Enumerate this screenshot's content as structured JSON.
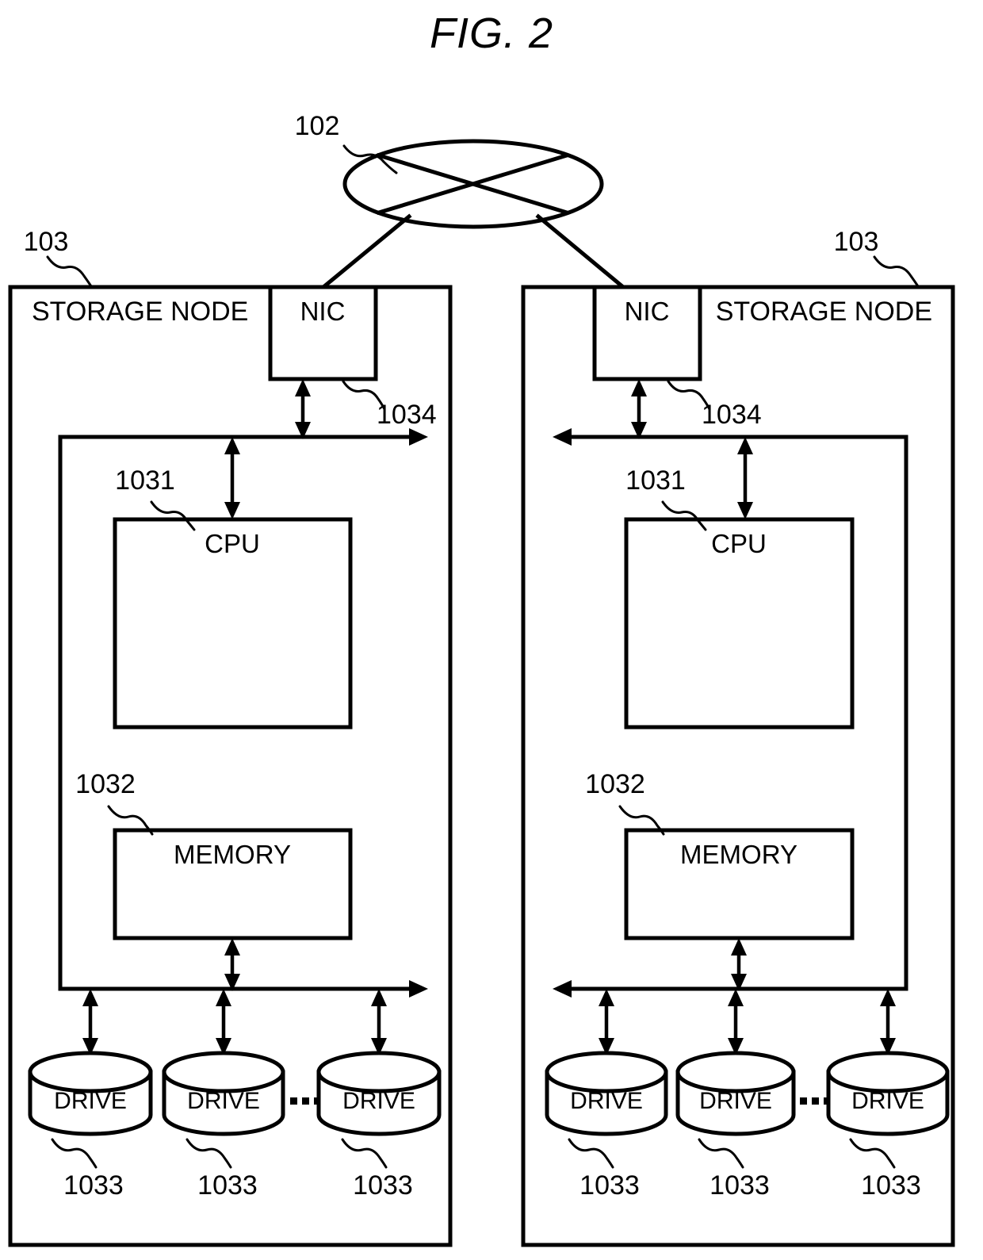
{
  "figure": {
    "title": "FIG. 2",
    "background_color": "#ffffff",
    "line_color": "#000000"
  },
  "network": {
    "symbol": "network-cloud-ellipse-with-x",
    "ref": "102"
  },
  "nodes": [
    {
      "side": "left",
      "ref": "103",
      "title": "STORAGE NODE",
      "nic": {
        "label": "NIC",
        "ref": "1034"
      },
      "bus": {
        "ref": "1034",
        "direction": "right"
      },
      "cpu": {
        "label": "CPU",
        "ref": "1031"
      },
      "memory": {
        "label": "MEMORY",
        "ref": "1032"
      },
      "drives": [
        {
          "label": "DRIVE",
          "ref": "1033"
        },
        {
          "label": "DRIVE",
          "ref": "1033"
        },
        {
          "label": "DRIVE",
          "ref": "1033"
        }
      ],
      "drive_ellipsis": "..."
    },
    {
      "side": "right",
      "ref": "103",
      "title": "STORAGE NODE",
      "nic": {
        "label": "NIC",
        "ref": "1034"
      },
      "bus": {
        "ref": "1034",
        "direction": "left"
      },
      "cpu": {
        "label": "CPU",
        "ref": "1031"
      },
      "memory": {
        "label": "MEMORY",
        "ref": "1032"
      },
      "drives": [
        {
          "label": "DRIVE",
          "ref": "1033"
        },
        {
          "label": "DRIVE",
          "ref": "1033"
        },
        {
          "label": "DRIVE",
          "ref": "1033"
        }
      ],
      "drive_ellipsis": "..."
    }
  ]
}
